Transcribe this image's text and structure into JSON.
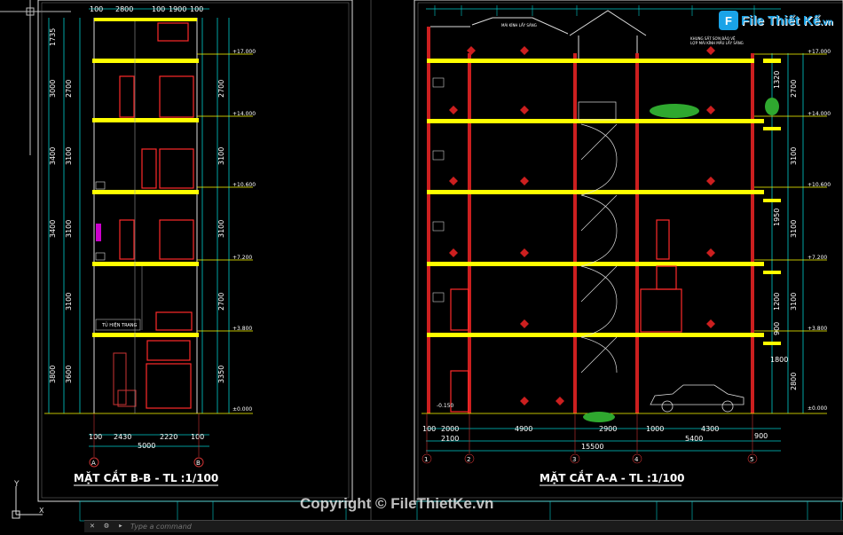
{
  "watermark": {
    "text": "Copyright © FileThietKe.vn"
  },
  "logo": {
    "mark": "F",
    "name": "File Thiết Kế",
    ".vn": ".vn",
    "suffix": ".vn"
  },
  "command": {
    "placeholder": "Type a command"
  },
  "axis": {
    "y_label": "Y",
    "x_label": "X"
  },
  "left_sheet": {
    "title": "MẶT CẮT B-B - TL :1/100",
    "top_dims": [
      "100",
      "2800",
      "100",
      "1900",
      "100"
    ],
    "bottom_dims": [
      "2430",
      "2220"
    ],
    "bottom_total": "5000",
    "bottom_small": [
      "100",
      "100"
    ],
    "room_label": "TỦ HIỆN TRANG",
    "levels": [
      "+17.000",
      "+14.000",
      "+10.600",
      "+7.200",
      "+3.800",
      "±0.000"
    ],
    "left_dims": [
      "1735",
      "3000",
      "3400",
      "3400",
      "3800"
    ],
    "left_inner": [
      "2700",
      "3100",
      "3100",
      "3100",
      "3600"
    ],
    "right_dims": [
      "2700",
      "3100",
      "3100",
      "2700",
      "3350"
    ],
    "grid_bubbles": [
      "A",
      "B"
    ]
  },
  "right_sheet": {
    "title": "MẶT CẮT A-A - TL :1/100",
    "roof_note": "MÁI KÍNH LẤY SÁNG",
    "roof_note2": "KHUNG SẮT SƠN BẢO VỆ",
    "roof_note3": "LỢP MÁI KÍNH MẦU LẤY SÁNG",
    "levels": [
      "+17.000",
      "+14.000",
      "+10.600",
      "+7.200",
      "+3.800",
      "±0.000",
      "-0.150"
    ],
    "bottom_dims": [
      "100",
      "2000",
      "4900",
      "2900",
      "4300"
    ],
    "bottom_dims2": [
      "2100",
      "5400"
    ],
    "bottom_total": "15500",
    "bottom_small": [
      "1000",
      "900"
    ],
    "right_dims": [
      "2700",
      "3100",
      "3100",
      "3100",
      "2800"
    ],
    "right_inner": [
      "1320",
      "1950",
      "1200",
      "900",
      "1800"
    ],
    "grid_bubbles": [
      "1",
      "2",
      "3",
      "4",
      "5"
    ]
  }
}
